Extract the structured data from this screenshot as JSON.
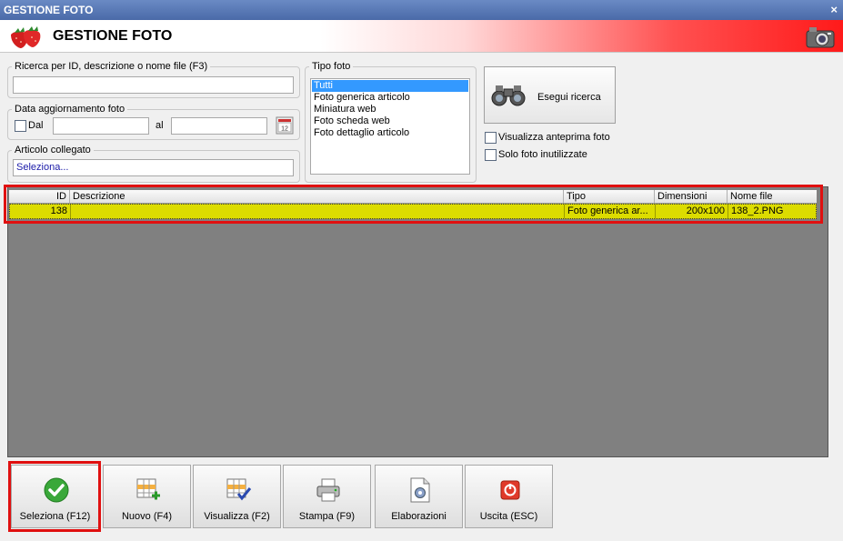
{
  "window": {
    "title": "GESTIONE FOTO",
    "close_glyph": "×"
  },
  "header": {
    "title": "GESTIONE FOTO",
    "left_icon": "strawberry-icon",
    "right_icon": "camera-icon"
  },
  "search": {
    "legend": "Ricerca per ID, descrizione o nome file (F3)",
    "value": ""
  },
  "date": {
    "legend": "Data aggiornamento foto",
    "dal_label": "Dal",
    "al_label": "al",
    "from_value": "",
    "to_value": "",
    "calendar_icon": "calendar-icon"
  },
  "article": {
    "legend": "Articolo collegato",
    "value": "Seleziona..."
  },
  "tipo_foto": {
    "legend": "Tipo foto",
    "options": [
      "Tutti",
      "Foto generica articolo",
      "Miniatura web",
      "Foto scheda web",
      "Foto dettaglio articolo"
    ],
    "selected": "Tutti"
  },
  "search_button": {
    "label": "Esegui ricerca",
    "icon": "binoculars-icon"
  },
  "options": {
    "preview_label": "Visualizza anteprima foto",
    "unused_label": "Solo foto inutilizzate"
  },
  "grid": {
    "columns": [
      "ID",
      "Descrizione",
      "Tipo",
      "Dimensioni",
      "Nome file"
    ],
    "rows": [
      {
        "id": "138",
        "descrizione": "",
        "tipo": "Foto generica ar...",
        "dimensioni": "200x100",
        "nome_file": "138_2.PNG"
      }
    ]
  },
  "toolbar": {
    "seleziona": "Seleziona (F12)",
    "nuovo": "Nuovo (F4)",
    "visualizza": "Visualizza (F2)",
    "stampa": "Stampa (F9)",
    "elaborazioni": "Elaborazioni",
    "uscita": "Uscita (ESC)"
  },
  "colors": {
    "highlight_row": "#dcdc00",
    "annotation_red": "#e01010",
    "selection_blue": "#3399ff"
  }
}
